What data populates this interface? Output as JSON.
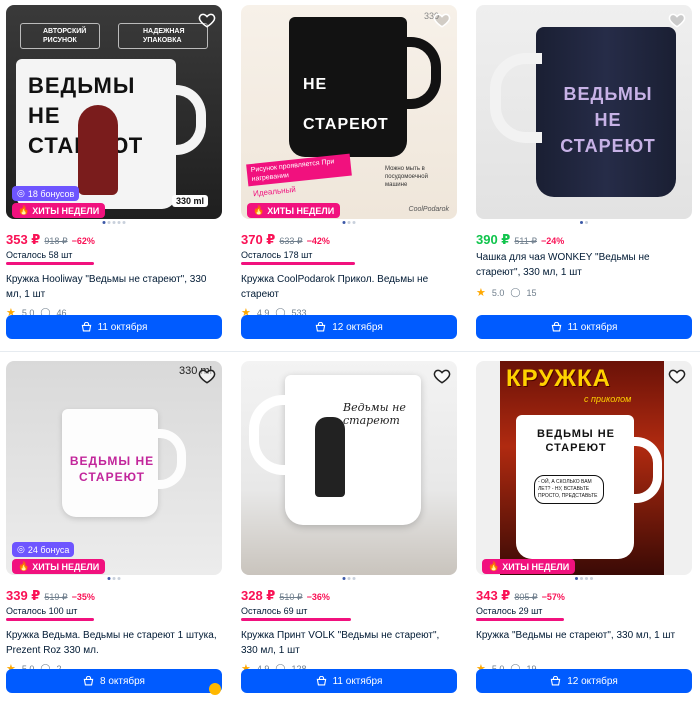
{
  "cards": [
    {
      "top_label_1": "АВТОРСКИЙ РИСУНОК",
      "top_label_2": "НАДЕЖНАЯ УПАКОВКА",
      "mug_text": "ВЕДЬМЫ НЕ СТАРЕЮТ",
      "volume": "330 ml",
      "bonus": "18 бонусов",
      "hits": "ХИТЫ НЕДЕЛИ",
      "price": "353 ₽",
      "old_price": "918 ₽",
      "discount": "−62%",
      "stock": "Осталось 58 шт",
      "title": "Кружка Hooliway \"Ведьмы не стареют\", 330 мл, 1 шт",
      "rating": "5.0",
      "reviews": "46",
      "delivery": "11 октября"
    },
    {
      "volume": "330",
      "banner": "Рисунок проявляется При нагревании",
      "dishwasher": "Можно мыть в посудомоечной машине",
      "side_note": "Идеальный",
      "mug_text": "НЕ СТАРЕЮТ",
      "brand": "CoolPodarok",
      "hits": "ХИТЫ НЕДЕЛИ",
      "price": "370 ₽",
      "old_price": "633 ₽",
      "discount": "−42%",
      "stock": "Осталось 178 шт",
      "title": "Кружка CoolPodarok Прикол. Ведьмы не стареют",
      "rating": "4.9",
      "reviews": "533",
      "delivery": "12 октября"
    },
    {
      "mug_text": "ВЕДЬМЫ НЕ СТАРЕЮТ",
      "price": "390 ₽",
      "old_price": "511 ₽",
      "discount": "−24%",
      "title": "Чашка для чая WONKEY \"Ведьмы не стареют\", 330 мл, 1 шт",
      "rating": "5.0",
      "reviews": "15",
      "delivery": "11 октября"
    },
    {
      "volume": "330 ml",
      "mug_text": "ВЕДЬМЫ НЕ СТАРЕЮТ",
      "bonus": "24 бонуса",
      "hits": "ХИТЫ НЕДЕЛИ",
      "price": "339 ₽",
      "old_price": "519 ₽",
      "discount": "−35%",
      "stock": "Осталось 100 шт",
      "title": "Кружка Ведьма. Ведьмы не стареют 1 штука, Prezent Roz 330 мл.",
      "rating": "5.0",
      "reviews": "2",
      "delivery": "8 октября"
    },
    {
      "mug_text": "Ведьмы не стареют",
      "price": "328 ₽",
      "old_price": "510 ₽",
      "discount": "−36%",
      "stock": "Осталось 69 шт",
      "title": "Кружка Принт VOLK \"Ведьмы не стареют\", 330 мл, 1 шт",
      "rating": "4.9",
      "reviews": "128",
      "delivery": "11 октября"
    },
    {
      "header": "КРУЖКА",
      "header_sub": "с приколом",
      "mug_text": "ВЕДЬМЫ НЕ СТАРЕЮТ",
      "bubble": "- ОЙ, А СКОЛЬКО ВАМ ЛЕТ? - НУ, ВСТАВЬТЕ ПРОСТО, ПРЕДСТАВЬТЕ",
      "hits": "ХИТЫ НЕДЕЛИ",
      "price": "343 ₽",
      "old_price": "805 ₽",
      "discount": "−57%",
      "stock": "Осталось 29 шт",
      "title": "Кружка \"Ведьмы не стареют\", 330 мл, 1 шт",
      "rating": "5.0",
      "reviews": "19",
      "delivery": "12 октября"
    }
  ],
  "colors": {
    "accent": "#005bff",
    "price_red": "#f91155",
    "price_green": "#10c44c",
    "hits_pink": "#f1117e",
    "bonus_purple": "#6e55ff"
  }
}
